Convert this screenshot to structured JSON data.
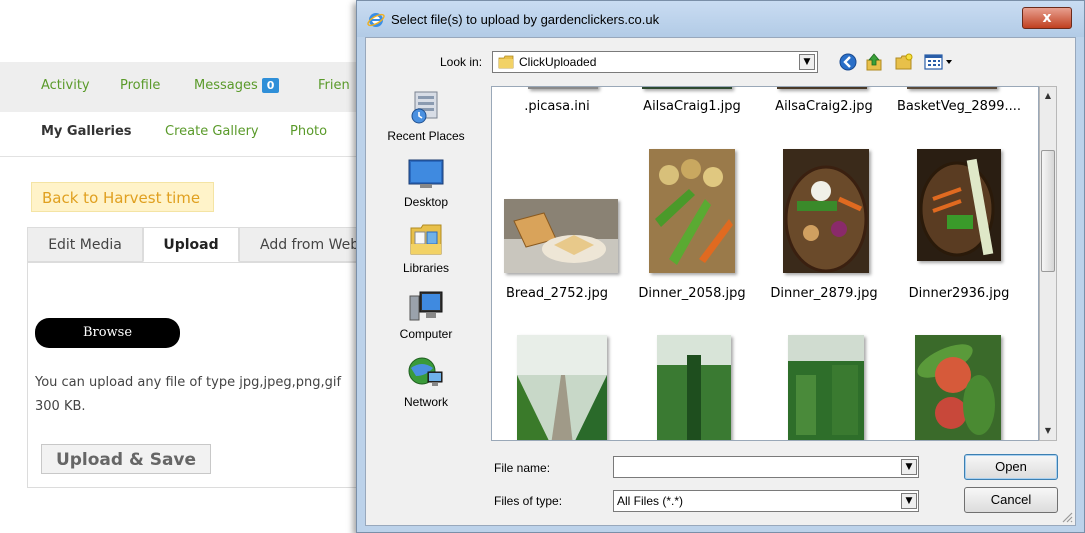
{
  "web": {
    "nav": [
      "Activity",
      "Profile",
      "Messages",
      "Frien"
    ],
    "messages_count": "0",
    "subnav": [
      "My Galleries",
      "Create Gallery",
      "Photo"
    ],
    "back_label": "Back to Harvest time",
    "tabs": [
      "Edit Media",
      "Upload",
      "Add from Web"
    ],
    "browse_label": "Browse",
    "info_line1": "You can upload any file of type jpg,jpeg,png,gif",
    "info_line2": "300 KB.",
    "upload_save_label": "Upload & Save"
  },
  "dialog": {
    "title": "Select file(s) to upload by gardenclickers.co.uk",
    "close": "x",
    "look_in_label": "Look in:",
    "look_in_value": "ClickUploaded",
    "places": [
      "Recent Places",
      "Desktop",
      "Libraries",
      "Computer",
      "Network"
    ],
    "files_row1": [
      ".picasa.ini",
      "AilsaCraig1.jpg",
      "AilsaCraig2.jpg",
      "BasketVeg_2899...."
    ],
    "files_row2": [
      "Bread_2752.jpg",
      "Dinner_2058.jpg",
      "Dinner_2879.jpg",
      "Dinner2936.jpg"
    ],
    "file_name_label": "File name:",
    "file_name_value": "",
    "file_type_label": "Files of type:",
    "file_type_value": "All Files (*.*)",
    "open_label": "Open",
    "cancel_label": "Cancel"
  },
  "colors": {
    "accent_green": "#5a9a2a",
    "badge_blue": "#2f8fd8",
    "back_bg": "#fff3c9",
    "dialog_frame": "#bcd2ea"
  }
}
